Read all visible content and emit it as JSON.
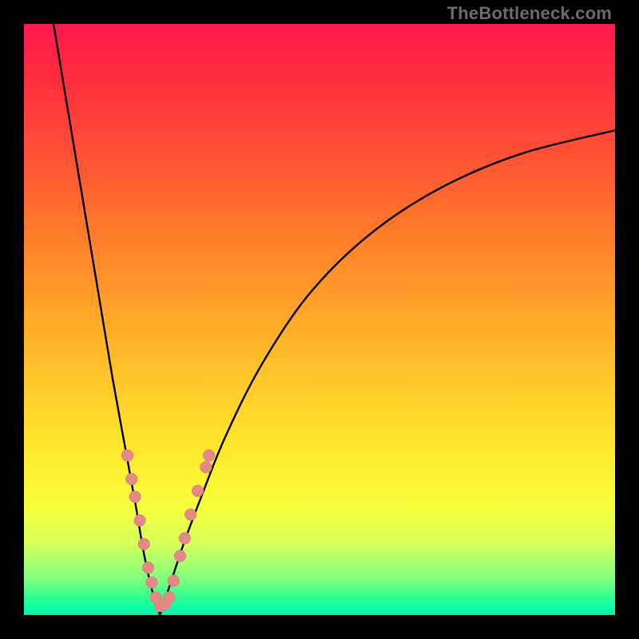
{
  "watermark": "TheBottleneck.com",
  "chart_data": {
    "type": "line",
    "title": "",
    "xlabel": "",
    "ylabel": "",
    "xlim": [
      0,
      100
    ],
    "ylim": [
      0,
      100
    ],
    "grid": false,
    "legend": false,
    "optimum_x": 23,
    "series": [
      {
        "name": "left-branch",
        "x": [
          5,
          7,
          9,
          11,
          13,
          15,
          17,
          19,
          20,
          21,
          22,
          23
        ],
        "y": [
          100,
          88,
          76,
          64,
          52,
          40,
          29,
          18,
          12,
          7,
          3,
          0
        ]
      },
      {
        "name": "right-branch",
        "x": [
          23,
          25,
          27,
          30,
          34,
          40,
          48,
          58,
          70,
          84,
          100
        ],
        "y": [
          0,
          6,
          12,
          20,
          30,
          42,
          54,
          64,
          72,
          78,
          82
        ]
      }
    ],
    "markers": {
      "name": "data-beads",
      "points": [
        {
          "x": 17.5,
          "y": 27
        },
        {
          "x": 18.2,
          "y": 23
        },
        {
          "x": 18.8,
          "y": 20
        },
        {
          "x": 19.6,
          "y": 16
        },
        {
          "x": 20.3,
          "y": 12
        },
        {
          "x": 21.0,
          "y": 8
        },
        {
          "x": 21.6,
          "y": 5.5
        },
        {
          "x": 22.3,
          "y": 3
        },
        {
          "x": 23.0,
          "y": 1.5
        },
        {
          "x": 23.8,
          "y": 1.8
        },
        {
          "x": 24.6,
          "y": 3
        },
        {
          "x": 25.3,
          "y": 5.8
        },
        {
          "x": 26.4,
          "y": 10
        },
        {
          "x": 27.2,
          "y": 13
        },
        {
          "x": 28.2,
          "y": 17
        },
        {
          "x": 29.4,
          "y": 21
        },
        {
          "x": 30.8,
          "y": 25
        },
        {
          "x": 31.3,
          "y": 27
        }
      ],
      "radius_data_units": 1.0
    },
    "background_gradient": {
      "top": "#ff1a4d",
      "mid": "#ffe82c",
      "bottom": "#0deeb0"
    }
  }
}
